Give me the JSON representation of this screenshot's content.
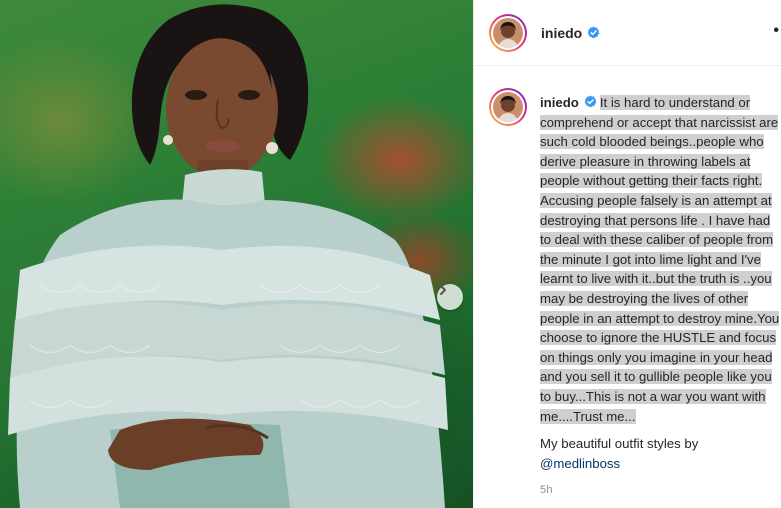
{
  "post": {
    "username": "iniedo",
    "verified": true,
    "caption": "It is hard to understand or comprehend or accept that narcissist are such cold blooded beings..people who derive pleasure in throwing labels at people without getting their facts right. Accusing people falsely is an attempt at destroying that persons life . I have had to deal with these caliber of people from the minute I got into lime light and I've learnt to live with it..but the truth is ..you may be destroying the lives of other people in an attempt to destroy mine.You choose to ignore the HUSTLE and focus on things only you imagine in your head and you sell it to gullible people like you to buy...This is not a war you want with me....Trust me...",
    "outfit_line": "My beautiful outfit styles by",
    "mention": "@medlinboss",
    "time": "5h",
    "more_icon": "•"
  },
  "colors": {
    "verified_blue": "#3897f0",
    "mention_blue": "#00376b",
    "highlight_gray": "#cfcfcf"
  },
  "icons": {
    "next": "chevron-right-icon",
    "verified": "verified-badge-icon",
    "more": "more-options-icon"
  }
}
